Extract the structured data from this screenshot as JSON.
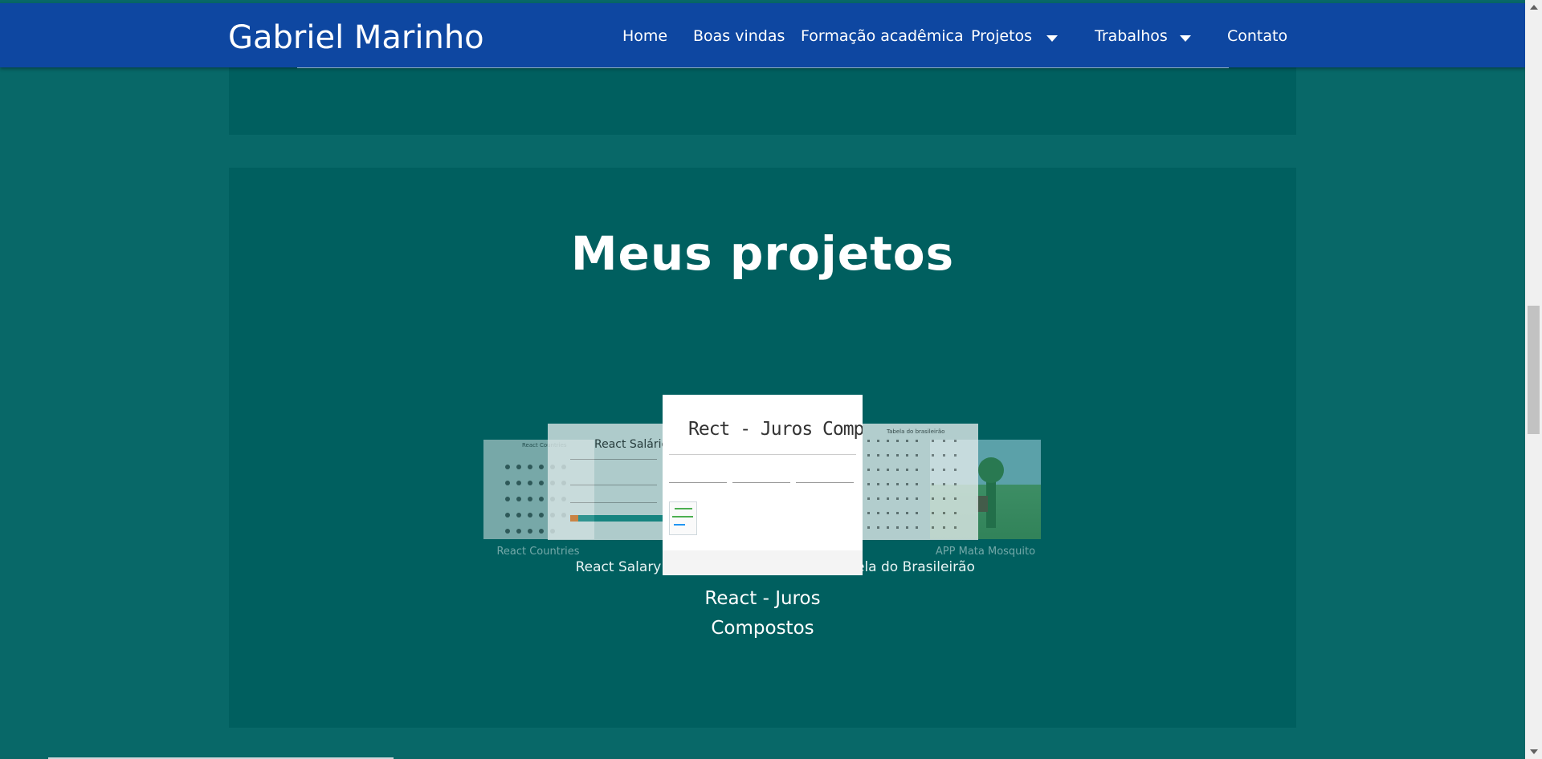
{
  "navbar": {
    "brand": "Gabriel Marinho",
    "items": [
      {
        "label": "Home"
      },
      {
        "label": "Boas vindas"
      },
      {
        "label": "Formação acadêmica"
      },
      {
        "label": "Projetos",
        "has_dropdown": true
      },
      {
        "label": "Trabalhos",
        "has_dropdown": true
      },
      {
        "label": "Contato"
      }
    ]
  },
  "projects": {
    "title": "Meus projetos",
    "carousel": [
      {
        "label": "React Countries",
        "state": "far-left"
      },
      {
        "label": "React Salary",
        "state": "left",
        "screenshot_title": "React Salário"
      },
      {
        "label": "React - Juros Compostos",
        "state": "active",
        "screenshot_title": "Rect - Juros Compostos"
      },
      {
        "label": "Tabela do Brasileirão",
        "state": "right",
        "visible_label": "ela do Brasileirão"
      },
      {
        "label": "APP Mata Mosquito",
        "state": "far-right"
      }
    ],
    "active_label_lines": [
      "React - Juros",
      "Compostos"
    ]
  },
  "colors": {
    "navbar": "#0e47a1",
    "page_background": "#086868",
    "section_background": "#005f5f",
    "text": "#ffffff"
  }
}
